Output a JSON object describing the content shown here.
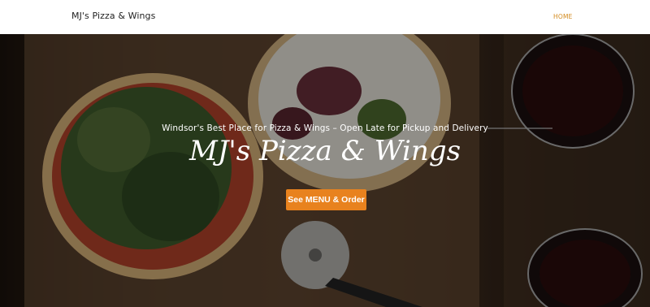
{
  "header": {
    "brand": "MJ's Pizza & Wings",
    "nav": [
      {
        "label": "HOME",
        "active": true
      }
    ]
  },
  "hero": {
    "tagline": "Windsor's Best Place for Pizza & Wings – Open Late for Pickup and Delivery",
    "title": "MJ's Pizza & Wings",
    "cta_label": "See MENU & Order"
  },
  "colors": {
    "accent": "#e8821e",
    "nav_active": "#d38a1c",
    "header_bg": "#ffffff"
  }
}
